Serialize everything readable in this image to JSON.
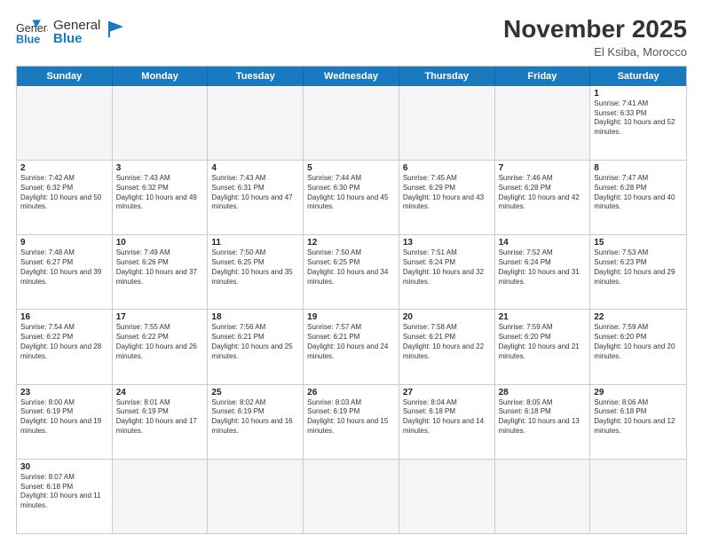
{
  "header": {
    "logo_general": "General",
    "logo_blue": "Blue",
    "month_title": "November 2025",
    "location": "El Ksiba, Morocco"
  },
  "days_of_week": [
    "Sunday",
    "Monday",
    "Tuesday",
    "Wednesday",
    "Thursday",
    "Friday",
    "Saturday"
  ],
  "weeks": [
    [
      {
        "day": "",
        "sunrise": "",
        "sunset": "",
        "daylight": "",
        "empty": true
      },
      {
        "day": "",
        "sunrise": "",
        "sunset": "",
        "daylight": "",
        "empty": true
      },
      {
        "day": "",
        "sunrise": "",
        "sunset": "",
        "daylight": "",
        "empty": true
      },
      {
        "day": "",
        "sunrise": "",
        "sunset": "",
        "daylight": "",
        "empty": true
      },
      {
        "day": "",
        "sunrise": "",
        "sunset": "",
        "daylight": "",
        "empty": true
      },
      {
        "day": "",
        "sunrise": "",
        "sunset": "",
        "daylight": "",
        "empty": true
      },
      {
        "day": "1",
        "sunrise": "Sunrise: 7:41 AM",
        "sunset": "Sunset: 6:33 PM",
        "daylight": "Daylight: 10 hours and 52 minutes.",
        "empty": false
      }
    ],
    [
      {
        "day": "2",
        "sunrise": "Sunrise: 7:42 AM",
        "sunset": "Sunset: 6:32 PM",
        "daylight": "Daylight: 10 hours and 50 minutes.",
        "empty": false
      },
      {
        "day": "3",
        "sunrise": "Sunrise: 7:43 AM",
        "sunset": "Sunset: 6:32 PM",
        "daylight": "Daylight: 10 hours and 49 minutes.",
        "empty": false
      },
      {
        "day": "4",
        "sunrise": "Sunrise: 7:43 AM",
        "sunset": "Sunset: 6:31 PM",
        "daylight": "Daylight: 10 hours and 47 minutes.",
        "empty": false
      },
      {
        "day": "5",
        "sunrise": "Sunrise: 7:44 AM",
        "sunset": "Sunset: 6:30 PM",
        "daylight": "Daylight: 10 hours and 45 minutes.",
        "empty": false
      },
      {
        "day": "6",
        "sunrise": "Sunrise: 7:45 AM",
        "sunset": "Sunset: 6:29 PM",
        "daylight": "Daylight: 10 hours and 43 minutes.",
        "empty": false
      },
      {
        "day": "7",
        "sunrise": "Sunrise: 7:46 AM",
        "sunset": "Sunset: 6:28 PM",
        "daylight": "Daylight: 10 hours and 42 minutes.",
        "empty": false
      },
      {
        "day": "8",
        "sunrise": "Sunrise: 7:47 AM",
        "sunset": "Sunset: 6:28 PM",
        "daylight": "Daylight: 10 hours and 40 minutes.",
        "empty": false
      }
    ],
    [
      {
        "day": "9",
        "sunrise": "Sunrise: 7:48 AM",
        "sunset": "Sunset: 6:27 PM",
        "daylight": "Daylight: 10 hours and 39 minutes.",
        "empty": false
      },
      {
        "day": "10",
        "sunrise": "Sunrise: 7:49 AM",
        "sunset": "Sunset: 6:26 PM",
        "daylight": "Daylight: 10 hours and 37 minutes.",
        "empty": false
      },
      {
        "day": "11",
        "sunrise": "Sunrise: 7:50 AM",
        "sunset": "Sunset: 6:25 PM",
        "daylight": "Daylight: 10 hours and 35 minutes.",
        "empty": false
      },
      {
        "day": "12",
        "sunrise": "Sunrise: 7:50 AM",
        "sunset": "Sunset: 6:25 PM",
        "daylight": "Daylight: 10 hours and 34 minutes.",
        "empty": false
      },
      {
        "day": "13",
        "sunrise": "Sunrise: 7:51 AM",
        "sunset": "Sunset: 6:24 PM",
        "daylight": "Daylight: 10 hours and 32 minutes.",
        "empty": false
      },
      {
        "day": "14",
        "sunrise": "Sunrise: 7:52 AM",
        "sunset": "Sunset: 6:24 PM",
        "daylight": "Daylight: 10 hours and 31 minutes.",
        "empty": false
      },
      {
        "day": "15",
        "sunrise": "Sunrise: 7:53 AM",
        "sunset": "Sunset: 6:23 PM",
        "daylight": "Daylight: 10 hours and 29 minutes.",
        "empty": false
      }
    ],
    [
      {
        "day": "16",
        "sunrise": "Sunrise: 7:54 AM",
        "sunset": "Sunset: 6:22 PM",
        "daylight": "Daylight: 10 hours and 28 minutes.",
        "empty": false
      },
      {
        "day": "17",
        "sunrise": "Sunrise: 7:55 AM",
        "sunset": "Sunset: 6:22 PM",
        "daylight": "Daylight: 10 hours and 26 minutes.",
        "empty": false
      },
      {
        "day": "18",
        "sunrise": "Sunrise: 7:56 AM",
        "sunset": "Sunset: 6:21 PM",
        "daylight": "Daylight: 10 hours and 25 minutes.",
        "empty": false
      },
      {
        "day": "19",
        "sunrise": "Sunrise: 7:57 AM",
        "sunset": "Sunset: 6:21 PM",
        "daylight": "Daylight: 10 hours and 24 minutes.",
        "empty": false
      },
      {
        "day": "20",
        "sunrise": "Sunrise: 7:58 AM",
        "sunset": "Sunset: 6:21 PM",
        "daylight": "Daylight: 10 hours and 22 minutes.",
        "empty": false
      },
      {
        "day": "21",
        "sunrise": "Sunrise: 7:59 AM",
        "sunset": "Sunset: 6:20 PM",
        "daylight": "Daylight: 10 hours and 21 minutes.",
        "empty": false
      },
      {
        "day": "22",
        "sunrise": "Sunrise: 7:59 AM",
        "sunset": "Sunset: 6:20 PM",
        "daylight": "Daylight: 10 hours and 20 minutes.",
        "empty": false
      }
    ],
    [
      {
        "day": "23",
        "sunrise": "Sunrise: 8:00 AM",
        "sunset": "Sunset: 6:19 PM",
        "daylight": "Daylight: 10 hours and 19 minutes.",
        "empty": false
      },
      {
        "day": "24",
        "sunrise": "Sunrise: 8:01 AM",
        "sunset": "Sunset: 6:19 PM",
        "daylight": "Daylight: 10 hours and 17 minutes.",
        "empty": false
      },
      {
        "day": "25",
        "sunrise": "Sunrise: 8:02 AM",
        "sunset": "Sunset: 6:19 PM",
        "daylight": "Daylight: 10 hours and 16 minutes.",
        "empty": false
      },
      {
        "day": "26",
        "sunrise": "Sunrise: 8:03 AM",
        "sunset": "Sunset: 6:19 PM",
        "daylight": "Daylight: 10 hours and 15 minutes.",
        "empty": false
      },
      {
        "day": "27",
        "sunrise": "Sunrise: 8:04 AM",
        "sunset": "Sunset: 6:18 PM",
        "daylight": "Daylight: 10 hours and 14 minutes.",
        "empty": false
      },
      {
        "day": "28",
        "sunrise": "Sunrise: 8:05 AM",
        "sunset": "Sunset: 6:18 PM",
        "daylight": "Daylight: 10 hours and 13 minutes.",
        "empty": false
      },
      {
        "day": "29",
        "sunrise": "Sunrise: 8:06 AM",
        "sunset": "Sunset: 6:18 PM",
        "daylight": "Daylight: 10 hours and 12 minutes.",
        "empty": false
      }
    ],
    [
      {
        "day": "30",
        "sunrise": "Sunrise: 8:07 AM",
        "sunset": "Sunset: 6:18 PM",
        "daylight": "Daylight: 10 hours and 11 minutes.",
        "empty": false
      },
      {
        "day": "",
        "empty": true
      },
      {
        "day": "",
        "empty": true
      },
      {
        "day": "",
        "empty": true
      },
      {
        "day": "",
        "empty": true
      },
      {
        "day": "",
        "empty": true
      },
      {
        "day": "",
        "empty": true
      }
    ]
  ]
}
